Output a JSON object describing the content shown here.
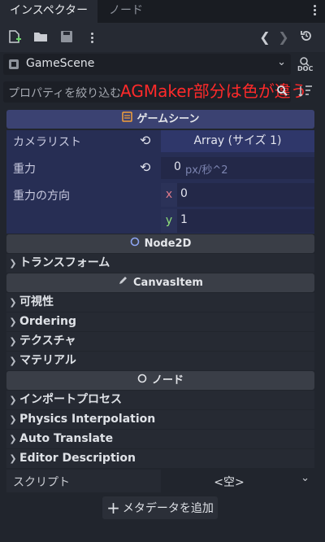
{
  "tabs": [
    {
      "label": "インスペクター",
      "active": true
    },
    {
      "label": "ノード",
      "active": false
    }
  ],
  "toolbar": {
    "icons": [
      "new-resource-icon",
      "open-folder-icon",
      "save-icon",
      "more-options-icon",
      "back-icon",
      "forward-icon",
      "history-icon"
    ]
  },
  "object_selector": {
    "value": "GameScene",
    "doc_label": "DOC"
  },
  "filter": {
    "placeholder": "プロパティを絞り込む",
    "annotation": "AGMaker部分は色が違う"
  },
  "game_scene_section": {
    "title": "ゲームシーン",
    "properties": [
      {
        "label": "カメラリスト",
        "value": "Array (サイズ 1)"
      },
      {
        "label": "重力",
        "value": "0",
        "unit": "px/秒^2"
      },
      {
        "label": "重力の方向",
        "x_label": "x",
        "x_value": "0",
        "y_label": "y",
        "y_value": "1"
      }
    ]
  },
  "node2d_section": {
    "title": "Node2D",
    "items": [
      "トランスフォーム"
    ]
  },
  "canvasitem_section": {
    "title": "CanvasItem",
    "items": [
      "可視性",
      "Ordering",
      "テクスチャ",
      "マテリアル"
    ]
  },
  "node_section": {
    "title": "ノード",
    "items": [
      "インポートプロセス",
      "Physics Interpolation",
      "Auto Translate",
      "Editor Description"
    ]
  },
  "script_row": {
    "label": "スクリプト",
    "value": "<空>"
  },
  "add_metadata": {
    "label": "メタデータを追加"
  },
  "colors": {
    "accent_section": "#3b4272",
    "accent_panel": "#272e54",
    "annotation": "#ff2a2a",
    "node_section": "#3a3e47"
  }
}
